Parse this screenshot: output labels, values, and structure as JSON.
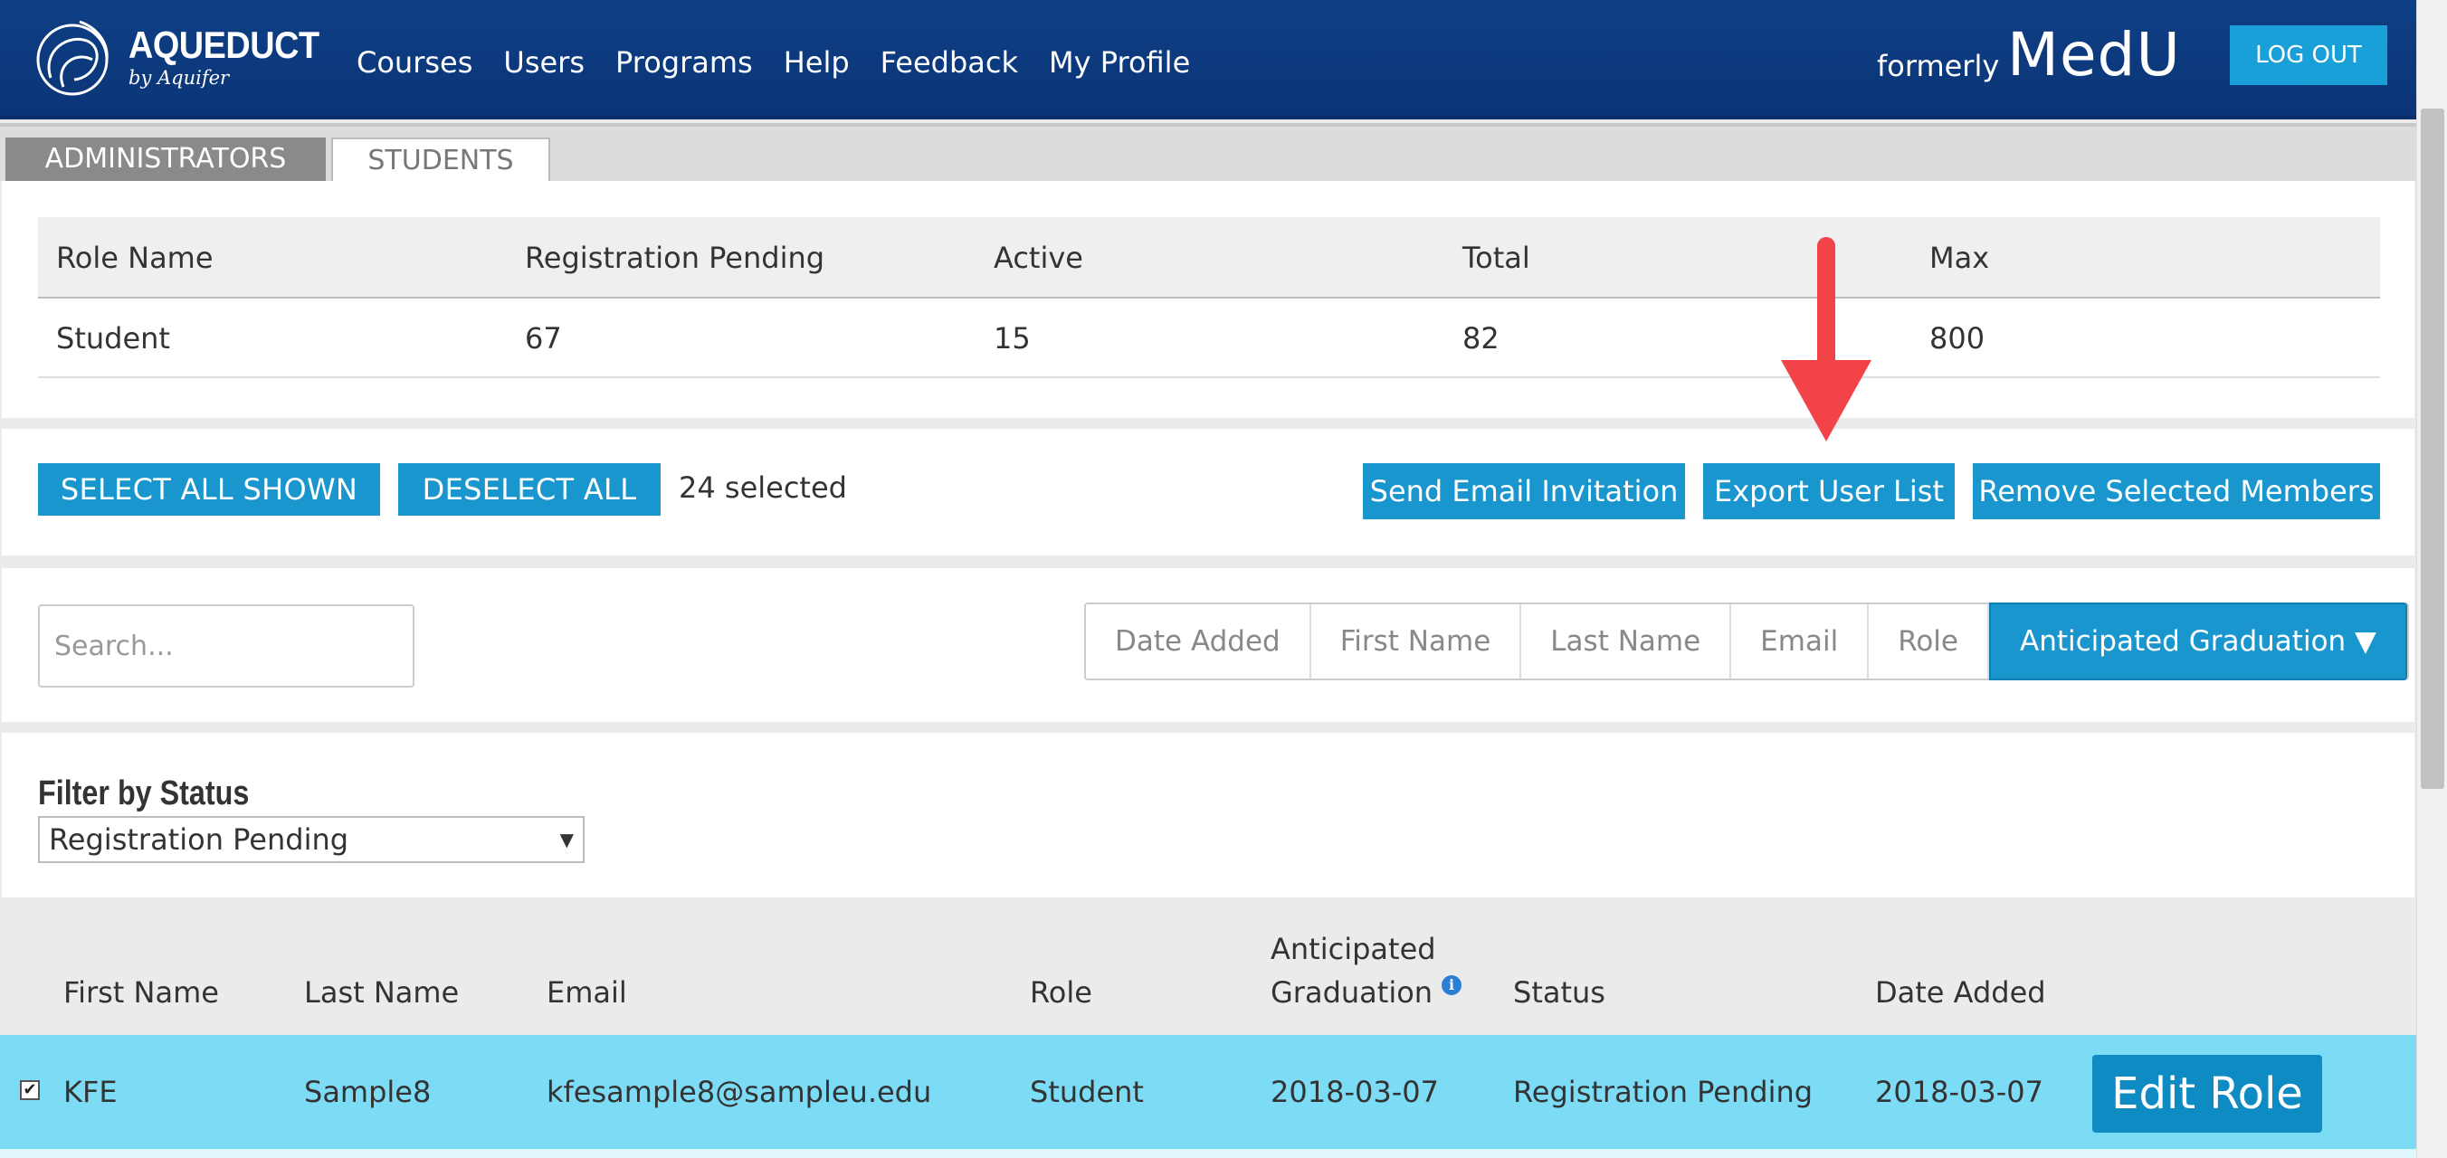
{
  "header": {
    "logo_title": "AQUEDUCT",
    "logo_subtitle": "by Aquifer",
    "nav": [
      "Courses",
      "Users",
      "Programs",
      "Help",
      "Feedback",
      "My Profile"
    ],
    "formerly": "formerly",
    "brand": "MedU",
    "logout_label": "LOG OUT"
  },
  "tabs": [
    {
      "label": "ADMINISTRATORS",
      "active": false
    },
    {
      "label": "STUDENTS",
      "active": true
    }
  ],
  "summary": {
    "headers": [
      "Role Name",
      "Registration Pending",
      "Active",
      "Total",
      "Max"
    ],
    "rows": [
      [
        "Student",
        "67",
        "15",
        "82",
        "800"
      ]
    ]
  },
  "actions": {
    "select_all": "SELECT ALL SHOWN",
    "deselect_all": "DESELECT ALL",
    "selected_count": "24 selected",
    "send_email": "Send Email Invitation",
    "export": "Export User List",
    "remove": "Remove Selected Members"
  },
  "search": {
    "placeholder": "Search..."
  },
  "sort": {
    "options": [
      "Date Added",
      "First Name",
      "Last Name",
      "Email",
      "Role"
    ],
    "active": "Anticipated Graduation ▼"
  },
  "filter": {
    "title": "Filter by Status",
    "selected": "Registration Pending"
  },
  "users": {
    "headers": {
      "first_name": "First Name",
      "last_name": "Last Name",
      "email": "Email",
      "role": "Role",
      "grad_line1": "Anticipated",
      "grad_line2": "Graduation",
      "status": "Status",
      "date_added": "Date Added"
    },
    "rows": [
      {
        "checked": true,
        "first_name": "KFE",
        "last_name": "Sample8",
        "email": "kfesample8@sampleu.edu",
        "role": "Student",
        "graduation": "2018-03-07",
        "status": "Registration Pending",
        "date_added": "2018-03-07",
        "edit_label": "Edit Role"
      }
    ]
  },
  "colors": {
    "header_bg": "#0f3f85",
    "button_blue": "#1a96cf",
    "row_highlight": "#7ddcf5",
    "annotation_arrow": "#f24448"
  },
  "icons": {
    "logo": "aqueduct-swirl-icon",
    "info": "info-icon",
    "checkbox": "checkbox-checked-icon",
    "annotation": "red-arrow-down-icon"
  }
}
